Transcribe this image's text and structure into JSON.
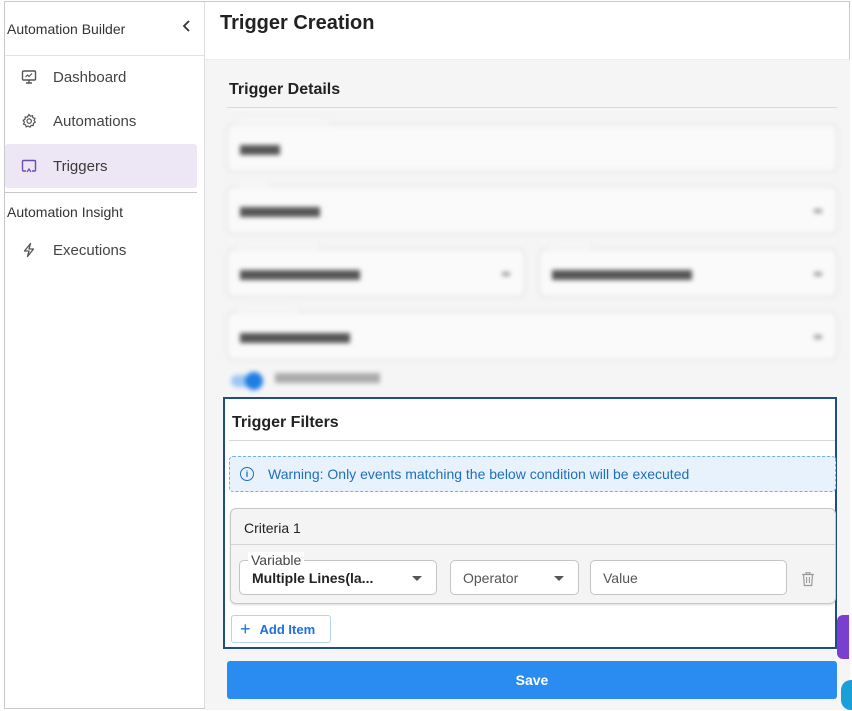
{
  "sidebar": {
    "title": "Automation Builder",
    "collapse_icon": "chevron-left-icon",
    "items": [
      {
        "label": "Dashboard",
        "icon": "monitor-icon"
      },
      {
        "label": "Automations",
        "icon": "gear-icon"
      },
      {
        "label": "Triggers",
        "icon": "screen-cast-icon",
        "active": true
      }
    ],
    "section_title": "Automation Insight",
    "section_items": [
      {
        "label": "Executions",
        "icon": "lightning-icon"
      }
    ]
  },
  "main": {
    "title": "Trigger Creation",
    "trigger_details": {
      "title": "Trigger Details"
    },
    "trigger_filters": {
      "title": "Trigger Filters",
      "warning": "Warning: Only events matching the below condition will be executed",
      "criteria": {
        "title": "Criteria 1",
        "variable_label": "Variable",
        "variable_value": "Multiple Lines(la...",
        "operator_placeholder": "Operator",
        "value_placeholder": "Value"
      },
      "add_item_label": "Add Item"
    },
    "save_label": "Save"
  },
  "colors": {
    "accent": "#2a8cf0",
    "active_nav_bg": "#ece6f5",
    "filters_border": "#1f4e86",
    "warning_bg": "#e7f2fc",
    "warning_text": "#1f6fbf"
  }
}
